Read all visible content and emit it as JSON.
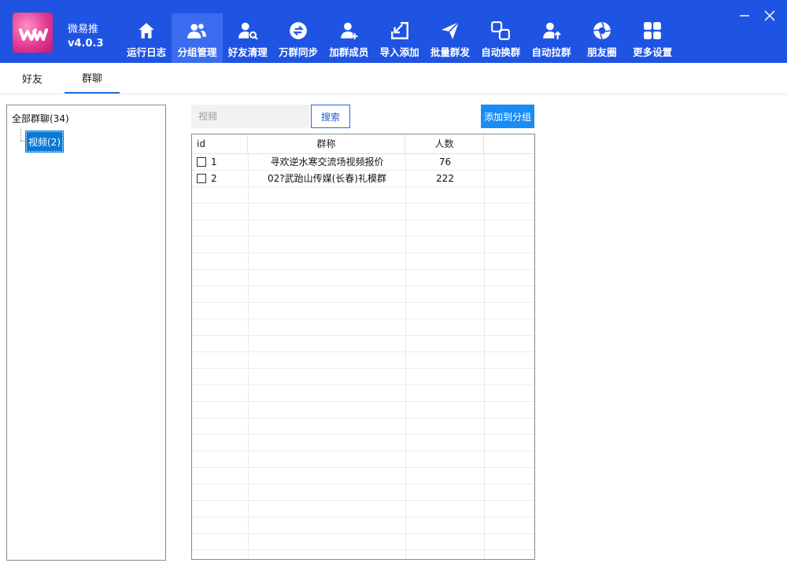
{
  "app": {
    "name": "微易推",
    "version": "v4.0.3"
  },
  "nav": [
    {
      "label": "运行日志",
      "icon": "home-icon",
      "active": false
    },
    {
      "label": "分组管理",
      "icon": "users-icon",
      "active": true
    },
    {
      "label": "好友清理",
      "icon": "user-search-icon",
      "active": false
    },
    {
      "label": "万群同步",
      "icon": "sync-icon",
      "active": false
    },
    {
      "label": "加群成员",
      "icon": "user-add-icon",
      "active": false
    },
    {
      "label": "导入添加",
      "icon": "import-icon",
      "active": false
    },
    {
      "label": "批量群发",
      "icon": "send-icon",
      "active": false
    },
    {
      "label": "自动换群",
      "icon": "swap-icon",
      "active": false
    },
    {
      "label": "自动拉群",
      "icon": "user-up-icon",
      "active": false
    },
    {
      "label": "朋友圈",
      "icon": "aperture-icon",
      "active": false
    },
    {
      "label": "更多设置",
      "icon": "grid-icon",
      "active": false
    }
  ],
  "tabs": {
    "friends": "好友",
    "groups": "群聊"
  },
  "tree": {
    "root": "全部群聊(34)",
    "child": "视频(2)"
  },
  "search": {
    "placeholder": "视频",
    "button": "搜索"
  },
  "add_button": "添加到分组",
  "table": {
    "columns": {
      "id": "id",
      "name": "群称",
      "count": "人数"
    },
    "rows": [
      {
        "id": "1",
        "name": "寻欢逆水寒交流场视频报价",
        "count": "76"
      },
      {
        "id": "2",
        "name": "02?武跆山传媒(长春)礼模群",
        "count": "222"
      }
    ]
  },
  "colors": {
    "header": "#1f54e2",
    "active_nav": "#3b6cf0",
    "accent": "#1a8cf5",
    "selection": "#0a78d7"
  }
}
